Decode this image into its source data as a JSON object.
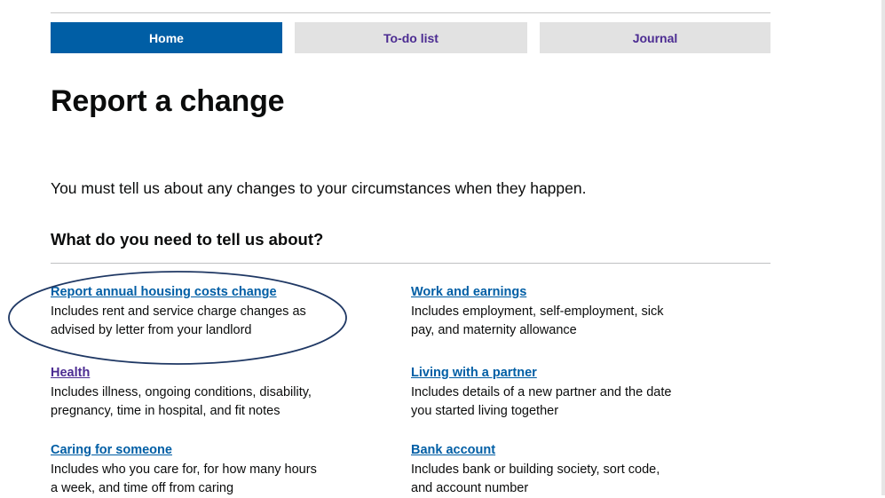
{
  "nav": {
    "tabs": [
      {
        "label": "Home",
        "active": true
      },
      {
        "label": "To-do list",
        "active": false
      },
      {
        "label": "Journal",
        "active": false
      }
    ]
  },
  "page": {
    "title": "Report a change",
    "lede": "You must tell us about any changes to your circumstances when they happen.",
    "section_heading": "What do you need to tell us about?"
  },
  "topics": [
    {
      "link": "Report annual housing costs change",
      "desc_line1": "Includes rent and service charge changes as",
      "desc_line2": "advised by letter from your landlord"
    },
    {
      "link": "Work and earnings",
      "desc_line1": "Includes employment, self-employment, sick",
      "desc_line2": "pay, and maternity allowance"
    },
    {
      "link": "Health",
      "desc_line1": "Includes illness, ongoing conditions, disability,",
      "desc_line2": "pregnancy, time in hospital, and fit notes"
    },
    {
      "link": "Living with a partner",
      "desc_line1": "Includes details of a new partner and the date",
      "desc_line2": "you started living together"
    },
    {
      "link": "Caring for someone",
      "desc_line1": "Includes who you care for, for how many hours",
      "desc_line2": "a week, and time off from caring"
    },
    {
      "link": "Bank account",
      "desc_line1": "Includes bank or building society, sort code,",
      "desc_line2": "and account number"
    }
  ],
  "colors": {
    "active_tab": "#005ea5",
    "inactive_tab": "#e2e2e2",
    "link": "#005ea5",
    "visited_link": "#4c2c92",
    "annotation": "#1f3864"
  }
}
